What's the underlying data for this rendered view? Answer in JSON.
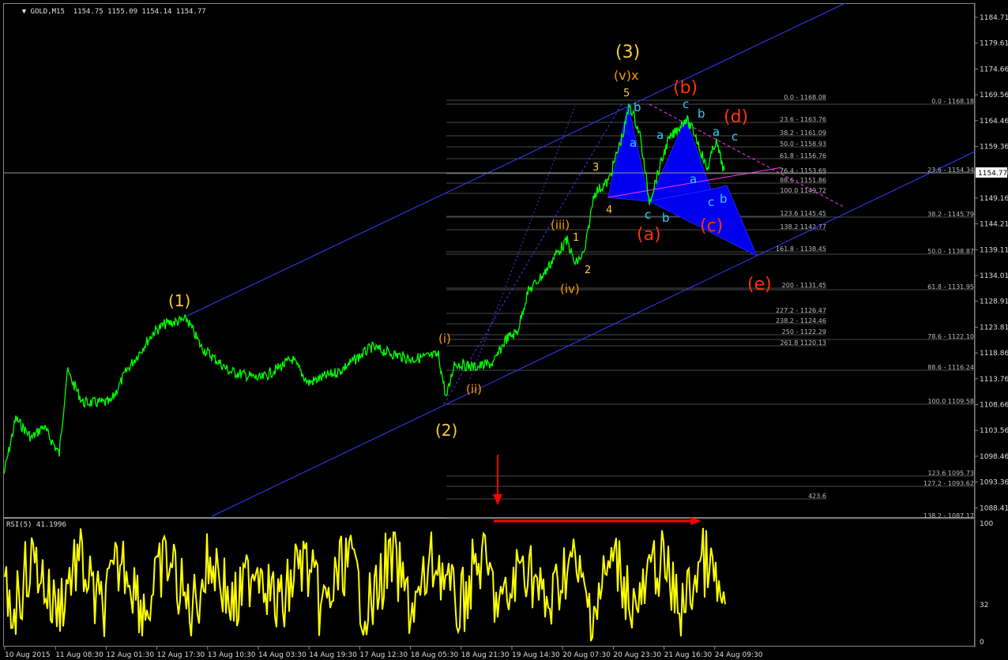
{
  "header": {
    "title": "GOLD,M15",
    "ohlc": "1154.75 1155.09 1154.14 1154.77"
  },
  "price_axis": [
    "1184.71",
    "1179.61",
    "1174.66",
    "1169.56",
    "1164.46",
    "1159.36",
    "1154.26",
    "1149.16",
    "1144.21",
    "1139.11",
    "1134.01",
    "1128.91",
    "1123.81",
    "1118.86",
    "1113.76",
    "1108.66",
    "1103.56",
    "1098.46",
    "1093.36",
    "1088.41"
  ],
  "current_price": "1154.77",
  "time_axis": [
    "10 Aug 2015",
    "11 Aug 08:30",
    "12 Aug 01:30",
    "12 Aug 17:30",
    "13 Aug 10:30",
    "14 Aug 03:30",
    "14 Aug 19:30",
    "17 Aug 12:30",
    "18 Aug 05:30",
    "18 Aug 21:30",
    "19 Aug 14:30",
    "20 Aug 07:30",
    "20 Aug 23:30",
    "21 Aug 16:30",
    "24 Aug 09:30"
  ],
  "rsi": {
    "label": "RSI(5) 41.1996",
    "axis": [
      "100",
      "32",
      "0"
    ]
  },
  "fib_left": [
    "0.0 - 1168.08",
    "23.6 - 1163.76",
    "38.2 - 1161.09",
    "50.0 - 1158.93",
    "61.8 - 1156.76",
    "76.4 - 1153.69",
    "88.6 - 1151.86",
    "100.0 1149.72",
    "123.6 1145.45",
    "138.2 1142.77",
    "161.8 - 1138.45",
    "200 - 1131.45",
    "227.2 - 1126.47",
    "238.2 - 1124.46",
    "250 - 1122.29",
    "261.8 1120.13",
    "423.6"
  ],
  "fib_right": [
    "0.0 - 1168.18",
    "23.6 - 1154.34",
    "38.2 - 1145.79",
    "50.0 - 1138.87",
    "61.8 - 1131.95",
    "78.6 - 1122.10",
    "88.6 - 1116.24",
    "100.0 1109.58",
    "123.6 1095.73",
    "127.2 - 1093.62",
    "138.2 - 1087.17"
  ],
  "waves": {
    "w1": "(1)",
    "w2": "(2)",
    "w3": "(3)",
    "vx": "(v)x",
    "i": "(i)",
    "ii": "(ii)",
    "iii": "(iii)",
    "iv": "(iv)",
    "n1": "1",
    "n2": "2",
    "n3": "3",
    "n4": "4",
    "n5": "5",
    "a": "(a)",
    "b": "(b)",
    "c": "(c)",
    "d": "(d)",
    "e": "(e)",
    "sa": "a",
    "sb": "b",
    "sc": "c"
  },
  "colors": {
    "price": "#00ff00",
    "rsi": "#ffff00",
    "channel": "#3333ff",
    "wave_major": "#ffcc33",
    "wave_minor": "#ff9900",
    "wave_red": "#ff3300",
    "wave_cyan": "#33ccff",
    "triangle": "#0000ee",
    "arrow": "#ff0000"
  }
}
